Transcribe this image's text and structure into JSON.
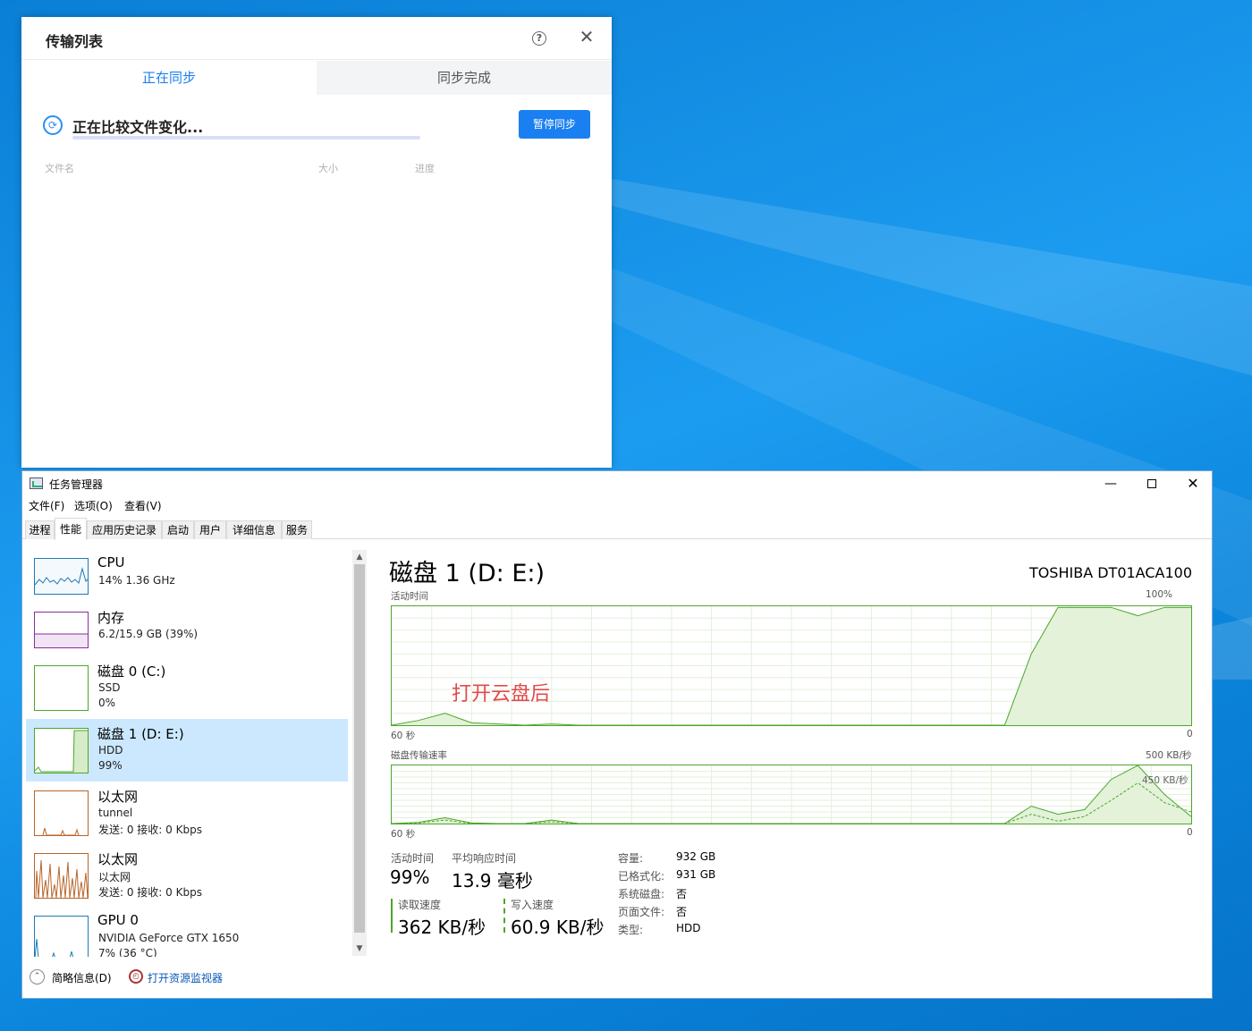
{
  "transfer_window": {
    "title": "传输列表",
    "help_glyph": "?",
    "close_glyph": "✕",
    "tabs": [
      {
        "label": "正在同步",
        "active": true
      },
      {
        "label": "同步完成",
        "active": false
      }
    ],
    "status_text": "正在比较文件变化...",
    "pause_button": "暂停同步",
    "columns": {
      "name": "文件名",
      "size": "大小",
      "progress": "进度"
    },
    "accent_color": "#1a7ff0"
  },
  "task_manager": {
    "title": "任务管理器",
    "window_controls": {
      "minimize": "—",
      "close": "✕"
    },
    "menu": [
      "文件(F)",
      "选项(O)",
      "查看(V)"
    ],
    "tabs": [
      "进程",
      "性能",
      "应用历史记录",
      "启动",
      "用户",
      "详细信息",
      "服务"
    ],
    "active_tab": "性能",
    "sidebar": [
      {
        "name": "CPU",
        "line1": "14% 1.36 GHz",
        "line2": "",
        "color": "#1e7ab6",
        "selected": false
      },
      {
        "name": "内存",
        "line1": "6.2/15.9 GB (39%)",
        "line2": "",
        "color": "#8b2e9b",
        "selected": false
      },
      {
        "name": "磁盘 0 (C:)",
        "line1": "SSD",
        "line2": "0%",
        "color": "#4ca62a",
        "selected": false
      },
      {
        "name": "磁盘 1 (D: E:)",
        "line1": "HDD",
        "line2": "99%",
        "color": "#4ca62a",
        "selected": true
      },
      {
        "name": "以太网",
        "line1": "tunnel",
        "line2": "发送: 0 接收: 0 Kbps",
        "color": "#b7652a",
        "selected": false
      },
      {
        "name": "以太网",
        "line1": "以太网",
        "line2": "发送: 0 接收: 0 Kbps",
        "color": "#b7652a",
        "selected": false
      },
      {
        "name": "GPU 0",
        "line1": "NVIDIA GeForce GTX 1650",
        "line2": "7% (36 °C)",
        "color": "#1e7ab6",
        "selected": false
      }
    ],
    "footer": {
      "brief": "简略信息(D)",
      "resource_monitor": "打开资源监视器"
    },
    "detail": {
      "title": "磁盘 1 (D: E:)",
      "model": "TOSHIBA DT01ACA100",
      "annotation": "打开云盘后",
      "activity_chart": {
        "label": "活动时间",
        "max_label": "100%",
        "left_label": "60 秒",
        "right_label": "0"
      },
      "transfer_chart": {
        "label": "磁盘传输速率",
        "max_label": "500 KB/秒",
        "mid_label": "450 KB/秒",
        "left_label": "60 秒",
        "right_label": "0"
      },
      "stats": {
        "active_time_label": "活动时间",
        "active_time": "99%",
        "avg_response_label": "平均响应时间",
        "avg_response": "13.9 毫秒",
        "read_label": "读取速度",
        "read": "362 KB/秒",
        "write_label": "写入速度",
        "write": "60.9 KB/秒"
      },
      "info": [
        {
          "key": "容量:",
          "value": "932 GB"
        },
        {
          "key": "已格式化:",
          "value": "931 GB"
        },
        {
          "key": "系统磁盘:",
          "value": "否"
        },
        {
          "key": "页面文件:",
          "value": "否"
        },
        {
          "key": "类型:",
          "value": "HDD"
        }
      ],
      "disk_color": "#4ca62a"
    }
  },
  "chart_data": [
    {
      "type": "area",
      "title": "活动时间",
      "xlabel": "60 秒 → 0",
      "ylabel": "%",
      "ylim": [
        0,
        100
      ],
      "x": [
        60,
        58,
        56,
        54,
        52,
        50,
        48,
        46,
        44,
        14,
        12,
        10,
        8,
        6,
        4,
        2,
        0
      ],
      "series": [
        {
          "values": [
            0,
            4,
            10,
            2,
            1,
            0,
            1,
            0,
            0,
            0,
            60,
            99,
            99,
            99,
            92,
            99,
            99
          ]
        }
      ]
    },
    {
      "type": "line",
      "title": "磁盘传输速率",
      "xlabel": "60 秒 → 0",
      "ylabel": "KB/秒",
      "ylim": [
        0,
        500
      ],
      "x": [
        60,
        58,
        56,
        54,
        52,
        50,
        48,
        46,
        44,
        14,
        12,
        10,
        8,
        6,
        4,
        2,
        0
      ],
      "series": [
        {
          "values": [
            0,
            10,
            50,
            5,
            0,
            0,
            30,
            0,
            0,
            0,
            150,
            80,
            120,
            380,
            500,
            250,
            60
          ]
        },
        {
          "values": [
            0,
            5,
            30,
            0,
            0,
            0,
            15,
            0,
            0,
            0,
            80,
            20,
            60,
            200,
            350,
            180,
            100
          ]
        }
      ]
    }
  ]
}
